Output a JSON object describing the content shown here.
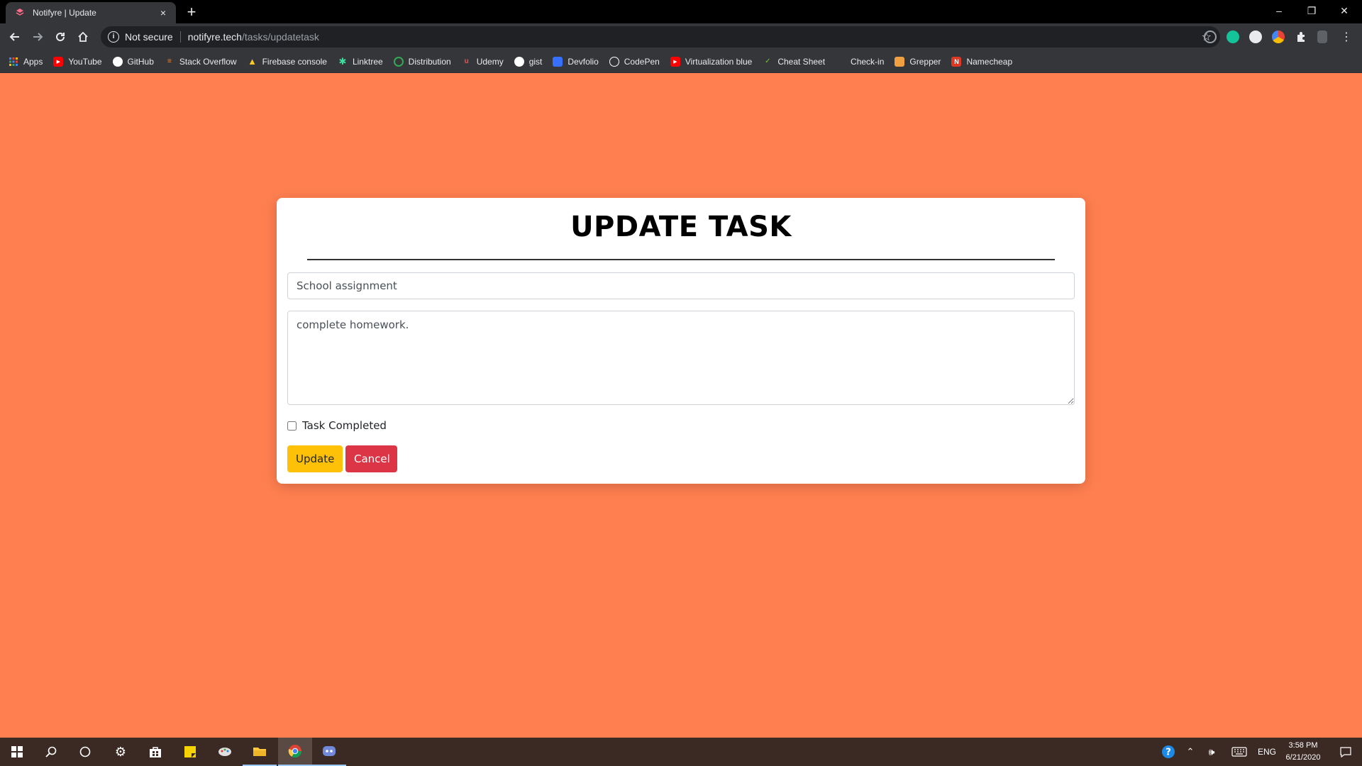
{
  "browser": {
    "tab_title": "Notifyre | Update",
    "tab_close": "×",
    "new_tab": "+",
    "address": {
      "security_label": "Not secure",
      "host": "notifyre.tech",
      "path": "/tasks/updatetask"
    },
    "window_controls": {
      "minimize": "–",
      "restore": "❐",
      "close": "✕"
    },
    "bookmarks": [
      {
        "label": "Apps",
        "icon": "apps-grid-icon",
        "color": "#4285f4"
      },
      {
        "label": "YouTube",
        "icon": "youtube-icon",
        "color": "#ff0000"
      },
      {
        "label": "GitHub",
        "icon": "github-icon",
        "color": "#ffffff"
      },
      {
        "label": "Stack Overflow",
        "icon": "stackoverflow-icon",
        "color": "#f48024"
      },
      {
        "label": "Firebase console",
        "icon": "firebase-icon",
        "color": "#ffca28"
      },
      {
        "label": "Linktree",
        "icon": "linktree-icon",
        "color": "#39e09b"
      },
      {
        "label": "Distribution",
        "icon": "distribution-icon",
        "color": "#34a853"
      },
      {
        "label": "Udemy",
        "icon": "udemy-icon",
        "color": "#ec5252"
      },
      {
        "label": "gist",
        "icon": "github-icon",
        "color": "#ffffff"
      },
      {
        "label": "Devfolio",
        "icon": "devfolio-icon",
        "color": "#3770ff"
      },
      {
        "label": "CodePen",
        "icon": "codepen-icon",
        "color": "#ffffff"
      },
      {
        "label": "Virtualization blue",
        "icon": "youtube-icon",
        "color": "#ff0000"
      },
      {
        "label": "Cheat Sheet",
        "icon": "cheatsheet-icon",
        "color": "#7cc242"
      },
      {
        "label": "Check-in",
        "icon": "checkin-icon",
        "color": "#35363a"
      },
      {
        "label": "Grepper",
        "icon": "grepper-icon",
        "color": "#f0a040"
      },
      {
        "label": "Namecheap",
        "icon": "namecheap-icon",
        "color": "#de3723"
      }
    ]
  },
  "page": {
    "background_color": "#ff7f50",
    "heading": "UPDATE TASK",
    "title_value": "School assignment",
    "description_value": "complete homework.",
    "completed_label": "Task Completed",
    "completed_checked": false,
    "update_label": "Update",
    "cancel_label": "Cancel",
    "update_color": "#ffc107",
    "cancel_color": "#dc3545"
  },
  "taskbar": {
    "language": "ENG",
    "time": "3:58 PM",
    "date": "6/21/2020"
  }
}
